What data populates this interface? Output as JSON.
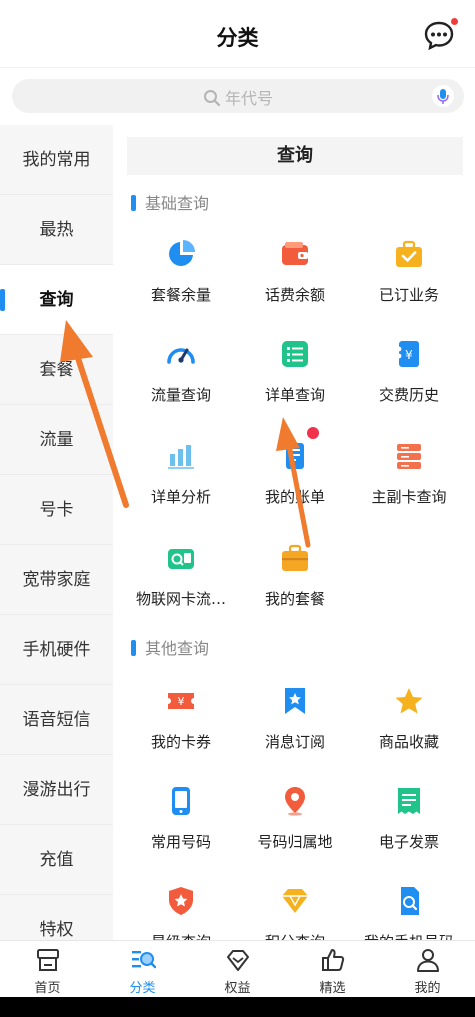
{
  "header": {
    "title": "分类"
  },
  "search": {
    "placeholder": "年代号"
  },
  "sidebar": {
    "items": [
      {
        "label": "我的常用"
      },
      {
        "label": "最热"
      },
      {
        "label": "查询"
      },
      {
        "label": "套餐"
      },
      {
        "label": "流量"
      },
      {
        "label": "号卡"
      },
      {
        "label": "宽带家庭"
      },
      {
        "label": "手机硬件"
      },
      {
        "label": "语音短信"
      },
      {
        "label": "漫游出行"
      },
      {
        "label": "充值"
      },
      {
        "label": "特权"
      }
    ],
    "active_index": 2
  },
  "content": {
    "title": "查询",
    "sections": [
      {
        "heading": "基础查询",
        "items": [
          {
            "label": "套餐余量",
            "icon": "pie-chart-icon"
          },
          {
            "label": "话费余额",
            "icon": "wallet-icon"
          },
          {
            "label": "已订业务",
            "icon": "briefcase-check-icon"
          },
          {
            "label": "流量查询",
            "icon": "speedometer-icon"
          },
          {
            "label": "详单查询",
            "icon": "list-icon"
          },
          {
            "label": "交费历史",
            "icon": "payment-history-icon"
          },
          {
            "label": "详单分析",
            "icon": "bar-chart-icon"
          },
          {
            "label": "我的账单",
            "icon": "bill-icon"
          },
          {
            "label": "主副卡查询",
            "icon": "cards-stack-icon"
          },
          {
            "label": "物联网卡流…",
            "icon": "iot-card-icon"
          },
          {
            "label": "我的套餐",
            "icon": "package-bag-icon"
          }
        ]
      },
      {
        "heading": "其他查询",
        "items": [
          {
            "label": "我的卡券",
            "icon": "coupon-icon"
          },
          {
            "label": "消息订阅",
            "icon": "bookmark-star-icon"
          },
          {
            "label": "商品收藏",
            "icon": "star-icon"
          },
          {
            "label": "常用号码",
            "icon": "phone-icon"
          },
          {
            "label": "号码归属地",
            "icon": "location-pin-icon"
          },
          {
            "label": "电子发票",
            "icon": "invoice-icon"
          },
          {
            "label": "星级查询",
            "icon": "shield-star-icon"
          },
          {
            "label": "积分查询",
            "icon": "diamond-icon"
          },
          {
            "label": "我的手机号码",
            "icon": "sim-search-icon"
          }
        ]
      }
    ]
  },
  "bottom_nav": {
    "items": [
      {
        "label": "首页",
        "icon": "home-icon"
      },
      {
        "label": "分类",
        "icon": "category-icon"
      },
      {
        "label": "权益",
        "icon": "gem-icon"
      },
      {
        "label": "精选",
        "icon": "thumbs-up-icon"
      },
      {
        "label": "我的",
        "icon": "person-icon"
      }
    ],
    "active_index": 1
  },
  "colors": {
    "accent": "#1f8ef0",
    "arrow": "#f07a2e",
    "badge": "#f2324a"
  }
}
